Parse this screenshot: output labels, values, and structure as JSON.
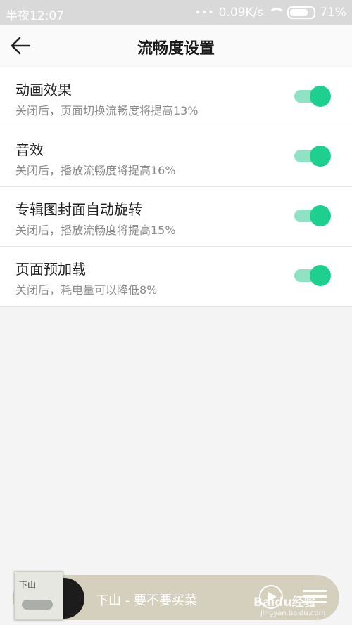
{
  "status_bar": {
    "time": "半夜12:07",
    "network_speed": "0.09K/s",
    "battery": "71%",
    "icons": [
      "signal-dots-icon",
      "wifi-icon",
      "battery-icon"
    ]
  },
  "header": {
    "title": "流畅度设置",
    "back_icon": "arrow-left-icon"
  },
  "settings": [
    {
      "label": "动画效果",
      "description": "关闭后，页面切换流畅度将提高13%",
      "enabled": true
    },
    {
      "label": "音效",
      "description": "关闭后，播放流畅度将提高16%",
      "enabled": true
    },
    {
      "label": "专辑图封面自动旋转",
      "description": "关闭后，播放流畅度将提高15%",
      "enabled": true
    },
    {
      "label": "页面预加载",
      "description": "关闭后，耗电量可以降低8%",
      "enabled": true
    }
  ],
  "player": {
    "song": "下山 - 要不要买菜",
    "cover_text": "下山",
    "play_icon": "play-icon",
    "queue_icon": "playlist-icon"
  },
  "watermark": {
    "text": "Baidu经验",
    "url": "jingyan.baidu.com"
  },
  "colors": {
    "accent": "#1fcf8f",
    "track": "#8fe3c4",
    "player_bg": "#d5d0bd"
  }
}
